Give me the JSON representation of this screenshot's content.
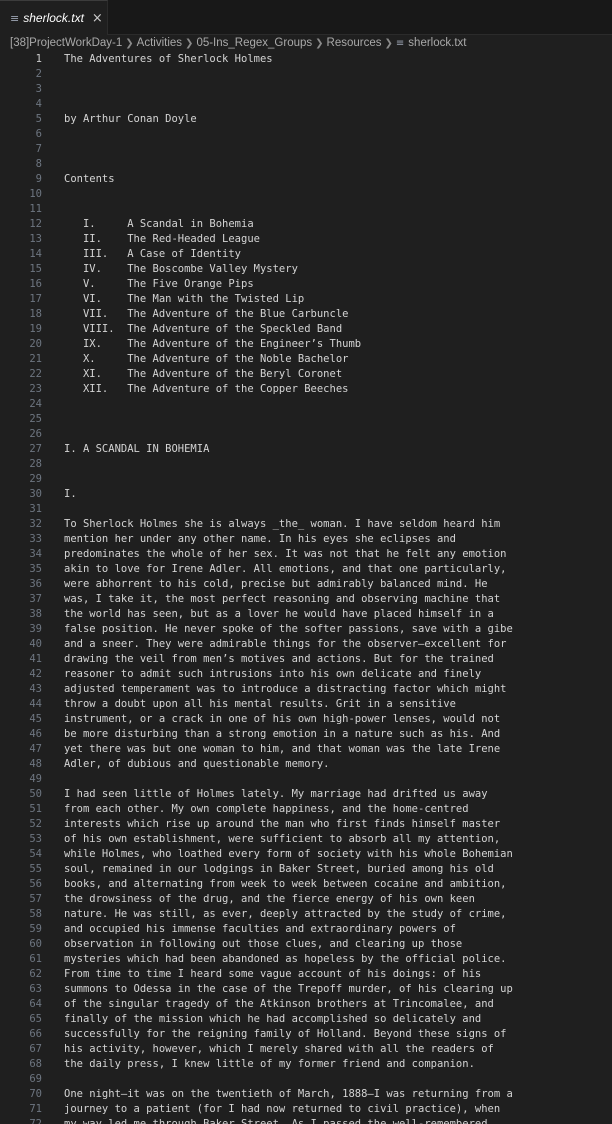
{
  "tab": {
    "icon": "file-text-icon",
    "label": "sherlock.txt",
    "close_glyph": "×"
  },
  "breadcrumb": [
    "[38]ProjectWorkDay-1",
    "Activities",
    "05-Ins_Regex_Groups",
    "Resources",
    "sherlock.txt"
  ],
  "editor": {
    "active_line": 1,
    "lines": [
      "The Adventures of Sherlock Holmes",
      "",
      "",
      "",
      "by Arthur Conan Doyle",
      "",
      "",
      "",
      "Contents",
      "",
      "",
      "   I.     A Scandal in Bohemia",
      "   II.    The Red-Headed League",
      "   III.   A Case of Identity",
      "   IV.    The Boscombe Valley Mystery",
      "   V.     The Five Orange Pips",
      "   VI.    The Man with the Twisted Lip",
      "   VII.   The Adventure of the Blue Carbuncle",
      "   VIII.  The Adventure of the Speckled Band",
      "   IX.    The Adventure of the Engineer’s Thumb",
      "   X.     The Adventure of the Noble Bachelor",
      "   XI.    The Adventure of the Beryl Coronet",
      "   XII.   The Adventure of the Copper Beeches",
      "",
      "",
      "",
      "I. A SCANDAL IN BOHEMIA",
      "",
      "",
      "I.",
      "",
      "To Sherlock Holmes she is always _the_ woman. I have seldom heard him",
      "mention her under any other name. In his eyes she eclipses and",
      "predominates the whole of her sex. It was not that he felt any emotion",
      "akin to love for Irene Adler. All emotions, and that one particularly,",
      "were abhorrent to his cold, precise but admirably balanced mind. He",
      "was, I take it, the most perfect reasoning and observing machine that",
      "the world has seen, but as a lover he would have placed himself in a",
      "false position. He never spoke of the softer passions, save with a gibe",
      "and a sneer. They were admirable things for the observer—excellent for",
      "drawing the veil from men’s motives and actions. But for the trained",
      "reasoner to admit such intrusions into his own delicate and finely",
      "adjusted temperament was to introduce a distracting factor which might",
      "throw a doubt upon all his mental results. Grit in a sensitive",
      "instrument, or a crack in one of his own high-power lenses, would not",
      "be more disturbing than a strong emotion in a nature such as his. And",
      "yet there was but one woman to him, and that woman was the late Irene",
      "Adler, of dubious and questionable memory.",
      "",
      "I had seen little of Holmes lately. My marriage had drifted us away",
      "from each other. My own complete happiness, and the home-centred",
      "interests which rise up around the man who first finds himself master",
      "of his own establishment, were sufficient to absorb all my attention,",
      "while Holmes, who loathed every form of society with his whole Bohemian",
      "soul, remained in our lodgings in Baker Street, buried among his old",
      "books, and alternating from week to week between cocaine and ambition,",
      "the drowsiness of the drug, and the fierce energy of his own keen",
      "nature. He was still, as ever, deeply attracted by the study of crime,",
      "and occupied his immense faculties and extraordinary powers of",
      "observation in following out those clues, and clearing up those",
      "mysteries which had been abandoned as hopeless by the official police.",
      "From time to time I heard some vague account of his doings: of his",
      "summons to Odessa in the case of the Trepoff murder, of his clearing up",
      "of the singular tragedy of the Atkinson brothers at Trincomalee, and",
      "finally of the mission which he had accomplished so delicately and",
      "successfully for the reigning family of Holland. Beyond these signs of",
      "his activity, however, which I merely shared with all the readers of",
      "the daily press, I knew little of my former friend and companion.",
      "",
      "One night—it was on the twentieth of March, 1888—I was returning from a",
      "journey to a patient (for I had now returned to civil practice), when",
      "my way led me through Baker Street. As I passed the well-remembered"
    ]
  }
}
